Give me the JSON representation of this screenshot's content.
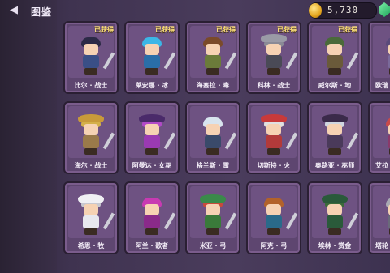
{
  "header": {
    "title": "图鉴",
    "coins": "5,730"
  },
  "cards": [
    {
      "name": "比尔 · 战士",
      "badge": "已获得",
      "hair": "#2c2a46",
      "body": "#3a4f86",
      "hat": ""
    },
    {
      "name": "莱安娜 · 冰",
      "badge": "已获得",
      "hair": "#3cb6e6",
      "body": "#2a6ea8",
      "hat": ""
    },
    {
      "name": "海塞拉 · 毒",
      "badge": "已获得",
      "hair": "#7a4a2a",
      "body": "#6b7b3a",
      "hat": ""
    },
    {
      "name": "科林 · 战士",
      "badge": "已获得",
      "hair": "#8a8a96",
      "body": "#4a4a56",
      "hat": "#9a9aa6"
    },
    {
      "name": "威尔斯 · 地",
      "badge": "已获得",
      "hair": "#4a6a3a",
      "body": "#6a5a3a",
      "hat": ""
    },
    {
      "name": "欧瑞",
      "badge": "",
      "hair": "#5a4a7a",
      "body": "#7a6a9a",
      "hat": ""
    },
    {
      "name": "海尔 · 战士",
      "badge": "",
      "hair": "#d4b04a",
      "body": "#9a7a4a",
      "hat": "#c89a3a"
    },
    {
      "name": "阿曼达 · 女巫",
      "badge": "",
      "hair": "#b24ac8",
      "body": "#9a3ab2",
      "hat": "#4a2a6a"
    },
    {
      "name": "格兰斯 · 雷",
      "badge": "",
      "hair": "#d8e4ee",
      "body": "#3a4a6a",
      "hat": ""
    },
    {
      "name": "切斯特 · 火",
      "badge": "",
      "hair": "#e0e0e0",
      "body": "#b23a3a",
      "hat": "#c83a3a"
    },
    {
      "name": "奥路亚 · 巫师",
      "badge": "",
      "hair": "#cfd6e0",
      "body": "#4a3a5a",
      "hat": "#3a2a4a"
    },
    {
      "name": "艾拉",
      "badge": "",
      "hair": "#c84a4a",
      "body": "#8a3a6a",
      "hat": ""
    },
    {
      "name": "希恩 · 牧",
      "badge": "",
      "hair": "#c8c8d0",
      "body": "#e8e8ee",
      "hat": "#f0f0f4"
    },
    {
      "name": "阿兰 · 歌者",
      "badge": "",
      "hair": "#c83ab2",
      "body": "#8a2a8a",
      "hat": ""
    },
    {
      "name": "米亚 · 弓",
      "badge": "",
      "hair": "#c84a3a",
      "body": "#3a7a3a",
      "hat": "#3a8a4a"
    },
    {
      "name": "阿克 · 弓",
      "badge": "",
      "hair": "#b2622a",
      "body": "#2a6a8a",
      "hat": ""
    },
    {
      "name": "埃林 · 赏金",
      "badge": "",
      "hair": "#3a6a3a",
      "body": "#2a5a3a",
      "hat": "#2a5a3a"
    },
    {
      "name": "塔轮",
      "badge": "",
      "hair": "#a8a8b2",
      "body": "#6a6a7a",
      "hat": ""
    }
  ]
}
